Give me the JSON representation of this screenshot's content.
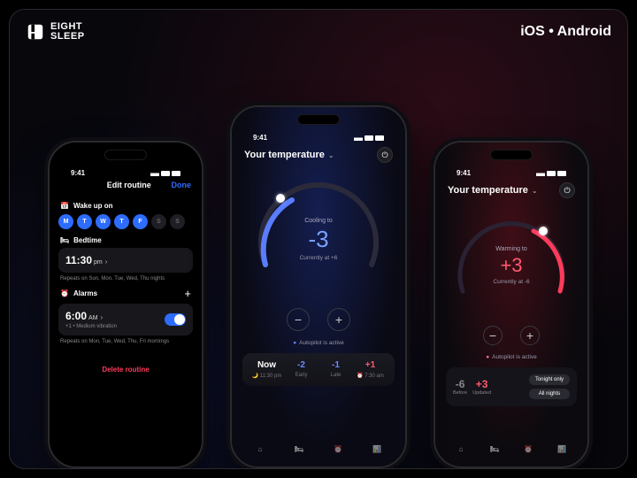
{
  "brand": {
    "line1": "EIGHT",
    "line2": "SLEEP"
  },
  "platforms": "iOS • Android",
  "statusTime": "9:41",
  "screen1": {
    "title": "Edit routine",
    "done": "Done",
    "wakeLabel": "Wake up on",
    "days": [
      {
        "l": "M",
        "on": true
      },
      {
        "l": "T",
        "on": true
      },
      {
        "l": "W",
        "on": true
      },
      {
        "l": "T",
        "on": true
      },
      {
        "l": "F",
        "on": true
      },
      {
        "l": "S",
        "on": false
      },
      {
        "l": "S",
        "on": false
      }
    ],
    "bedtimeLabel": "Bedtime",
    "bedtimeValue": "11:30",
    "bedtimeUnit": "pm",
    "bedtimeRepeats": "Repeats on Sun, Mon, Tue, Wed, Thu nights",
    "alarmsLabel": "Alarms",
    "alarmValue": "6:00",
    "alarmUnit": "AM",
    "alarmSub": "+1  •  Medium vibration",
    "alarmRepeats": "Repeats on Mon, Tue, Wed, Thu, Fri mornings",
    "delete": "Delete routine"
  },
  "screen2": {
    "title": "Your temperature",
    "statusLabel": "Cooling to",
    "value": "-3",
    "current": "Currently at +6",
    "autopilot": "Autopilot is active",
    "trend": [
      {
        "top": "Now",
        "bot": "🌙 11:30 pm",
        "cls": ""
      },
      {
        "top": "-2",
        "bot": "Early",
        "cls": "blue"
      },
      {
        "top": "-1",
        "bot": "Late",
        "cls": "blue"
      },
      {
        "top": "+1",
        "bot": "⏰ 7:30 am",
        "cls": "red"
      }
    ]
  },
  "screen3": {
    "title": "Your temperature",
    "statusLabel": "Warming to",
    "value": "+3",
    "current": "Currently at -6",
    "autopilot": "Autopilot is active",
    "before": {
      "n": "-6",
      "l": "Before"
    },
    "updated": {
      "n": "+3",
      "l": "Updated"
    },
    "btn1": "Tonight only",
    "btn2": "All nights"
  }
}
